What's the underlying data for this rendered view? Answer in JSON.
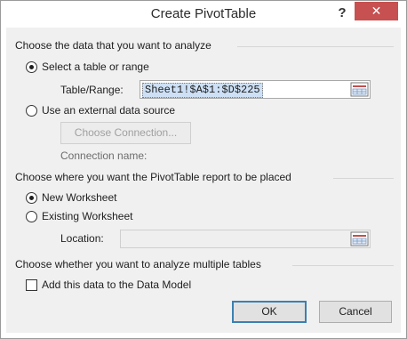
{
  "window": {
    "title": "Create PivotTable",
    "help_glyph": "?",
    "close_glyph": "✕"
  },
  "data_group": {
    "title": "Choose the data that you want to analyze",
    "select_table_label": "Select a table or range",
    "select_table_checked": true,
    "table_range_label": "Table/Range:",
    "table_range_value": "Sheet1!$A$1:$D$225",
    "external_source_label": "Use an external data source",
    "external_source_checked": false,
    "choose_connection_label": "Choose Connection...",
    "connection_name_label": "Connection name:"
  },
  "placement_group": {
    "title": "Choose where you want the PivotTable report to be placed",
    "new_worksheet_label": "New Worksheet",
    "new_worksheet_checked": true,
    "existing_worksheet_label": "Existing Worksheet",
    "existing_worksheet_checked": false,
    "location_label": "Location:",
    "location_value": ""
  },
  "multiple_tables_group": {
    "title": "Choose whether you want to analyze multiple tables",
    "data_model_label": "Add this data to the Data Model",
    "data_model_checked": false
  },
  "buttons": {
    "ok_label": "OK",
    "cancel_label": "Cancel"
  },
  "colors": {
    "close_button": "#c75050",
    "selection_highlight": "#cde0f5",
    "default_button_border": "#3c7fb1"
  }
}
